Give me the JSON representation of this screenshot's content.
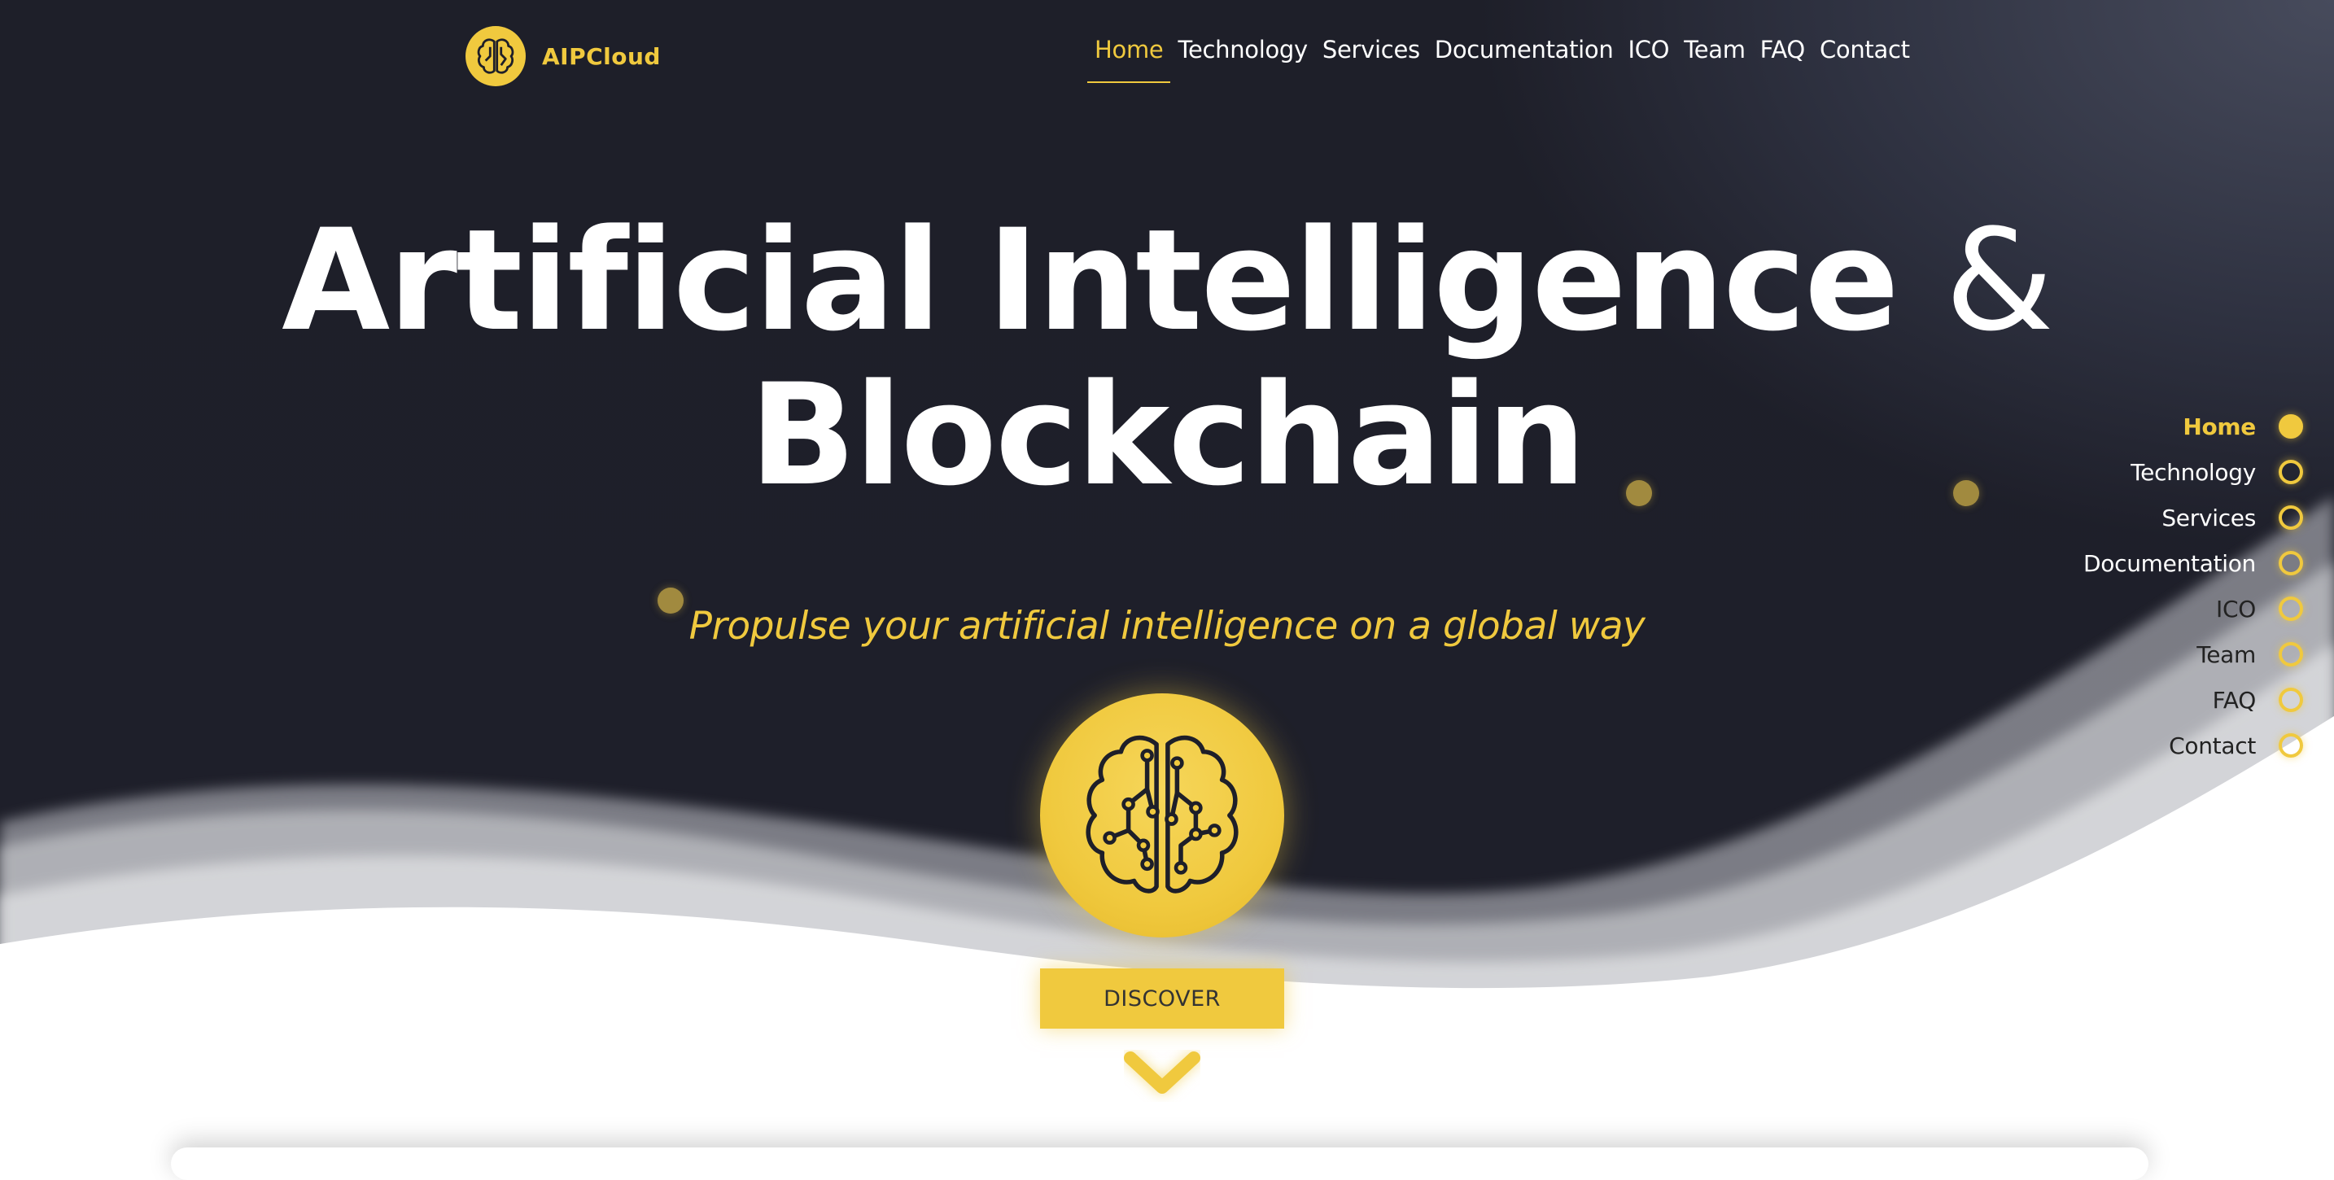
{
  "brand": {
    "name": "AIPCloud",
    "icon": "brain-circuit-icon"
  },
  "nav": {
    "items": [
      {
        "label": "Home",
        "active": true
      },
      {
        "label": "Technology",
        "active": false
      },
      {
        "label": "Services",
        "active": false
      },
      {
        "label": "Documentation",
        "active": false
      },
      {
        "label": "ICO",
        "active": false
      },
      {
        "label": "Team",
        "active": false
      },
      {
        "label": "FAQ",
        "active": false
      },
      {
        "label": "Contact",
        "active": false
      }
    ]
  },
  "hero": {
    "headline_part1": "Artificial Intelligence",
    "headline_amp": "&",
    "headline_part2": "Blockchain",
    "tagline": "Propulse your artificial intelligence on a global way",
    "emblem_icon": "brain-circuit-icon",
    "cta_label": "DISCOVER",
    "scroll_icon": "chevron-down-icon"
  },
  "side_nav": {
    "items": [
      {
        "label": "Home",
        "active": true
      },
      {
        "label": "Technology",
        "active": false
      },
      {
        "label": "Services",
        "active": false
      },
      {
        "label": "Documentation",
        "active": false
      },
      {
        "label": "ICO",
        "active": false
      },
      {
        "label": "Team",
        "active": false
      },
      {
        "label": "FAQ",
        "active": false
      },
      {
        "label": "Contact",
        "active": false
      }
    ]
  },
  "colors": {
    "accent": "#f0c93e",
    "dark_bg": "#1e1f29",
    "text_light": "#ffffff"
  }
}
